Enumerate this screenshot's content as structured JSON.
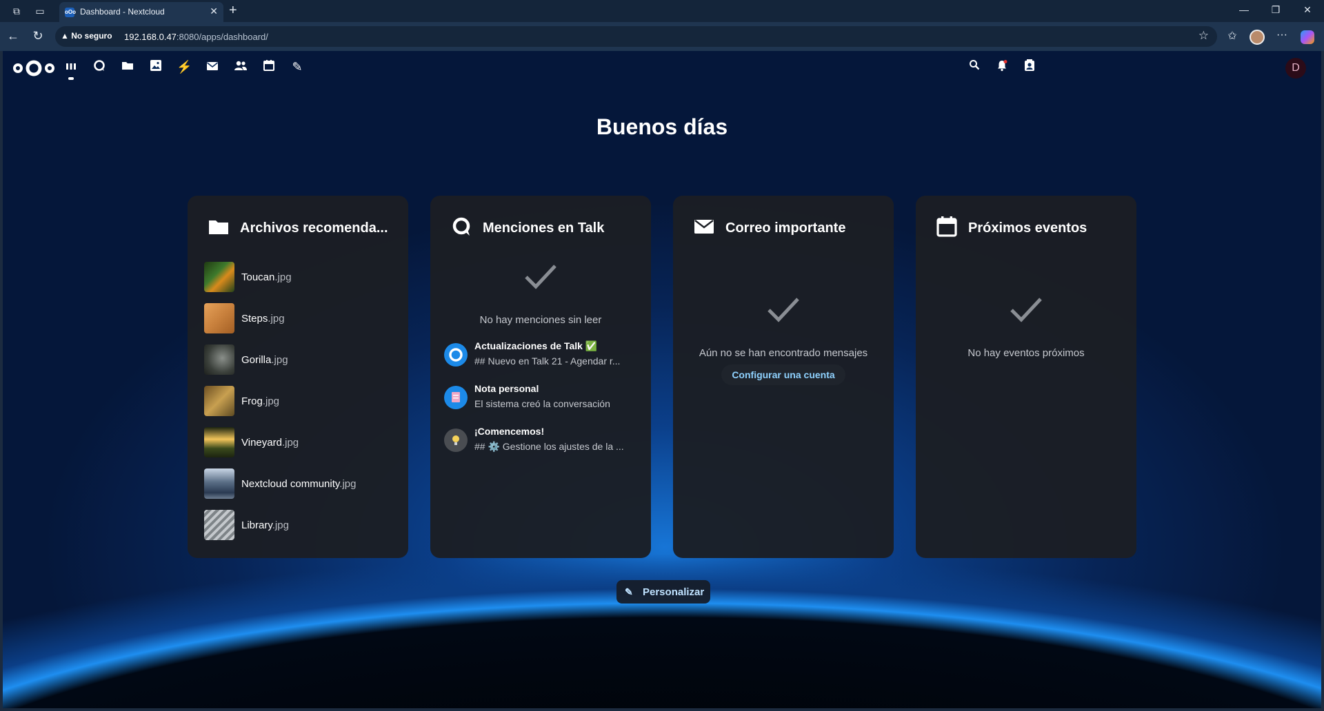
{
  "browser": {
    "tab_title": "Dashboard - Nextcloud",
    "security_label": "No seguro",
    "url_host": "192.168.0.47",
    "url_rest": ":8080/apps/dashboard/"
  },
  "header": {
    "apps": [
      {
        "name": "dashboard-app-icon",
        "glyph": "▮▮▮"
      },
      {
        "name": "talk-app-icon",
        "glyph": "Q"
      },
      {
        "name": "files-app-icon",
        "glyph": "folder"
      },
      {
        "name": "photos-app-icon",
        "glyph": "image"
      },
      {
        "name": "activity-app-icon",
        "glyph": "⚡"
      },
      {
        "name": "mail-app-icon",
        "glyph": "✉"
      },
      {
        "name": "contacts-app-icon",
        "glyph": "people"
      },
      {
        "name": "calendar-app-icon",
        "glyph": "calendar"
      },
      {
        "name": "notes-app-icon",
        "glyph": "✎"
      }
    ],
    "avatar_initial": "D"
  },
  "greeting": "Buenos días",
  "panels": {
    "files": {
      "title": "Archivos recomenda...",
      "items": [
        {
          "name": "Toucan",
          "ext": ".jpg",
          "color": "#3e7a2c"
        },
        {
          "name": "Steps",
          "ext": ".jpg",
          "color": "#c9813d"
        },
        {
          "name": "Gorilla",
          "ext": ".jpg",
          "color": "#4a4f4a"
        },
        {
          "name": "Frog",
          "ext": ".jpg",
          "color": "#9c7a3b"
        },
        {
          "name": "Vineyard",
          "ext": ".jpg",
          "color": "#7a6a2a"
        },
        {
          "name": "Nextcloud community",
          "ext": ".jpg",
          "color": "#5a6e86"
        },
        {
          "name": "Library",
          "ext": ".jpg",
          "color": "#9aa0a6"
        }
      ]
    },
    "talk": {
      "title": "Menciones en Talk",
      "empty": "No hay menciones sin leer",
      "items": [
        {
          "title": "Actualizaciones de Talk ✅",
          "subtitle": "## Nuevo en Talk 21 - Agendar r..."
        },
        {
          "title": "Nota personal",
          "subtitle": "El sistema creó la conversación"
        },
        {
          "title": "¡Comencemos!",
          "subtitle": "## ⚙️ Gestione los ajustes de la ..."
        }
      ]
    },
    "mail": {
      "title": "Correo importante",
      "empty": "Aún no se han encontrado mensajes",
      "action": "Configurar una cuenta"
    },
    "events": {
      "title": "Próximos eventos",
      "empty": "No hay eventos próximos"
    }
  },
  "customize_label": "Personalizar"
}
